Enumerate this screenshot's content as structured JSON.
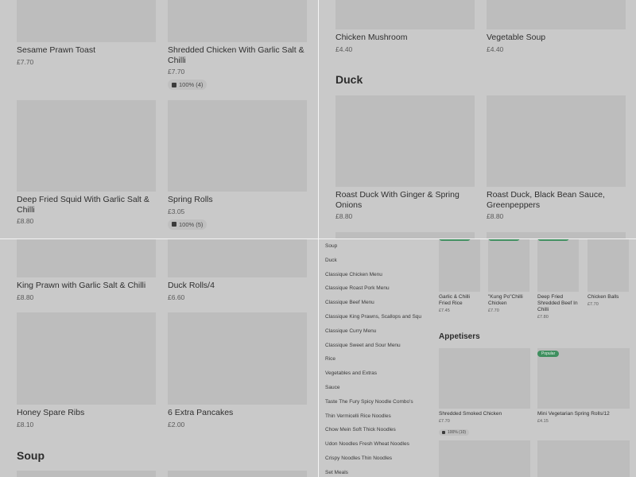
{
  "top_left": {
    "items": [
      {
        "name": "Sesame Prawn Toast",
        "price": "£7.70"
      },
      {
        "name": "Shredded Chicken With Garlic Salt & Chilli",
        "price": "£7.70",
        "rating": "100% (4)"
      },
      {
        "name": "Deep Fried Squid With Garlic Salt & Chilli",
        "price": "£8.80"
      },
      {
        "name": "Spring Rolls",
        "price": "£3.05",
        "rating": "100% (5)"
      }
    ]
  },
  "top_right": {
    "items_top": [
      {
        "name": "Chicken Mushroom",
        "price": "£4.40"
      },
      {
        "name": "Vegetable Soup",
        "price": "£4.40"
      }
    ],
    "section_title": "Duck",
    "items": [
      {
        "name": "Roast Duck With Ginger & Spring Onions",
        "price": "£8.80"
      },
      {
        "name": "Roast Duck, Black Bean Sauce, Greenpeppers",
        "price": "£8.80"
      }
    ]
  },
  "bottom_left": {
    "items": [
      {
        "name": "King Prawn with Garlic Salt & Chilli",
        "price": "£8.80"
      },
      {
        "name": "Duck Rolls/4",
        "price": "£6.60"
      },
      {
        "name": "Honey Spare Ribs",
        "price": "£8.10"
      },
      {
        "name": "6 Extra Pancakes",
        "price": "£2.00"
      }
    ],
    "section_title": "Soup"
  },
  "bottom_right": {
    "sidebar": [
      "Soup",
      "Duck",
      "Classique Chicken Menu",
      "Classique Roast Pork Menu",
      "Classique Beef Menu",
      "Classique King Prawns, Scallops and Squ",
      "Classique Curry Menu",
      "Classique Sweet and Sour Menu",
      "Rice",
      "Vegetables and Extras",
      "Sauce",
      "Taste The Fury Spicy Noodle Combo's",
      "Thin Vermicelli Rice Noodles",
      "Chow Mein Soft Thick Noodles",
      "Udon Noodles Fresh Wheat Noodles",
      "Crispy Noodles Thin Noodles",
      "Set Meals"
    ],
    "popular": [
      {
        "name": "Garlic & Chilli Fried Rice",
        "price": "£7.45"
      },
      {
        "name": "\"Kung Po\"Chilli Chicken",
        "price": "£7.70"
      },
      {
        "name": "Deep Fried Shredded Beef In Chilli",
        "price": "£7.80"
      },
      {
        "name": "Chicken Balls",
        "price": "£7.70"
      }
    ],
    "section_title": "Appetisers",
    "items": [
      {
        "name": "Shredded Smoked Chicken",
        "price": "£7.70",
        "rating": "100% (10)"
      },
      {
        "name": "Mini Vegetarian Spring Rolls/12",
        "price": "£4.15",
        "badge": "Popular"
      }
    ]
  },
  "colors": {
    "badge": "#3f8f5f",
    "placeholder": "#bdbdbd",
    "overlay": "#c9c9c9"
  }
}
